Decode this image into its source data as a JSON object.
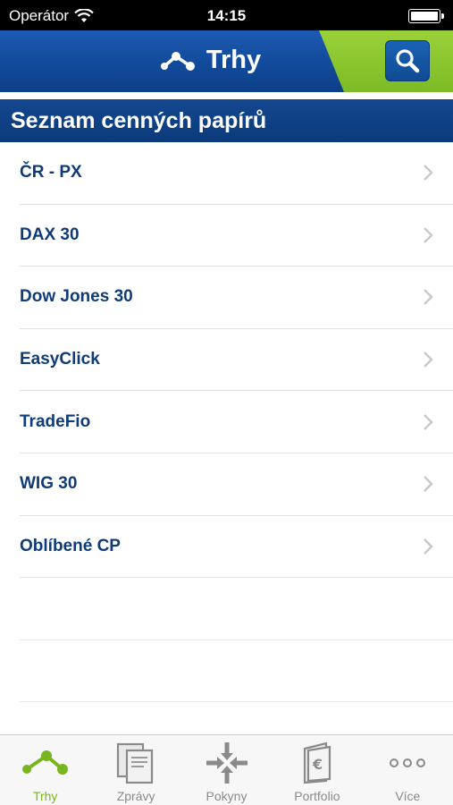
{
  "status_bar": {
    "carrier": "Operátor",
    "time": "14:15"
  },
  "header": {
    "title": "Trhy",
    "search_icon": "search-icon",
    "logo_icon": "market-chart-icon"
  },
  "section": {
    "title": "Seznam cenných papírů"
  },
  "list": {
    "items": [
      {
        "label": "ČR - PX"
      },
      {
        "label": "DAX 30"
      },
      {
        "label": "Dow Jones 30"
      },
      {
        "label": "EasyClick"
      },
      {
        "label": "TradeFio"
      },
      {
        "label": "WIG 30"
      },
      {
        "label": "Oblíbené CP"
      }
    ]
  },
  "tabs": [
    {
      "label": "Trhy",
      "icon": "market-chart-icon",
      "active": true
    },
    {
      "label": "Zprávy",
      "icon": "documents-icon",
      "active": false
    },
    {
      "label": "Pokyny",
      "icon": "arrows-converge-icon",
      "active": false
    },
    {
      "label": "Portfolio",
      "icon": "euro-wallet-icon",
      "active": false
    },
    {
      "label": "Více",
      "icon": "more-dots-icon",
      "active": false
    }
  ],
  "colors": {
    "brand_blue": "#124a9a",
    "brand_green": "#7cbb24",
    "list_text": "#0f3c78",
    "tab_inactive": "#8a8a8a"
  }
}
